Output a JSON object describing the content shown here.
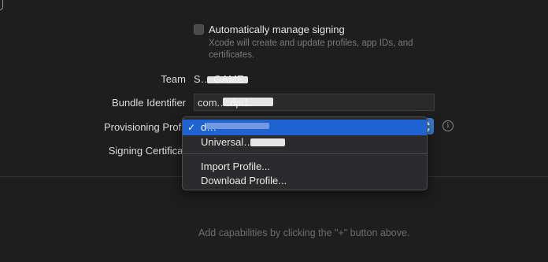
{
  "signing": {
    "auto_manage_label": "Automatically manage signing",
    "auto_manage_checked": false,
    "auto_manage_description": "Xcode will create and update profiles, app IDs, and certificates."
  },
  "team": {
    "label": "Team",
    "value": "S… GAME"
  },
  "bundle": {
    "label": "Bundle Identifier",
    "value": "com.…dpl1"
  },
  "provisioning": {
    "label": "Provisioning Profil",
    "menu_items": [
      {
        "label": "d…",
        "selected": true
      },
      {
        "label": "Universal…",
        "selected": false
      }
    ],
    "actions": [
      {
        "label": "Import Profile..."
      },
      {
        "label": "Download Profile..."
      }
    ]
  },
  "signing_certificate": {
    "label": "Signing Certificat"
  },
  "capabilities": {
    "hint": "Add capabilities by clicking the \"+\" button above."
  },
  "icons": {
    "info": "info-icon",
    "check": "checkmark-icon",
    "stepper": "chevron-updown-icon"
  },
  "colors": {
    "accent": "#1f62d1",
    "background": "#1e1e1e"
  }
}
